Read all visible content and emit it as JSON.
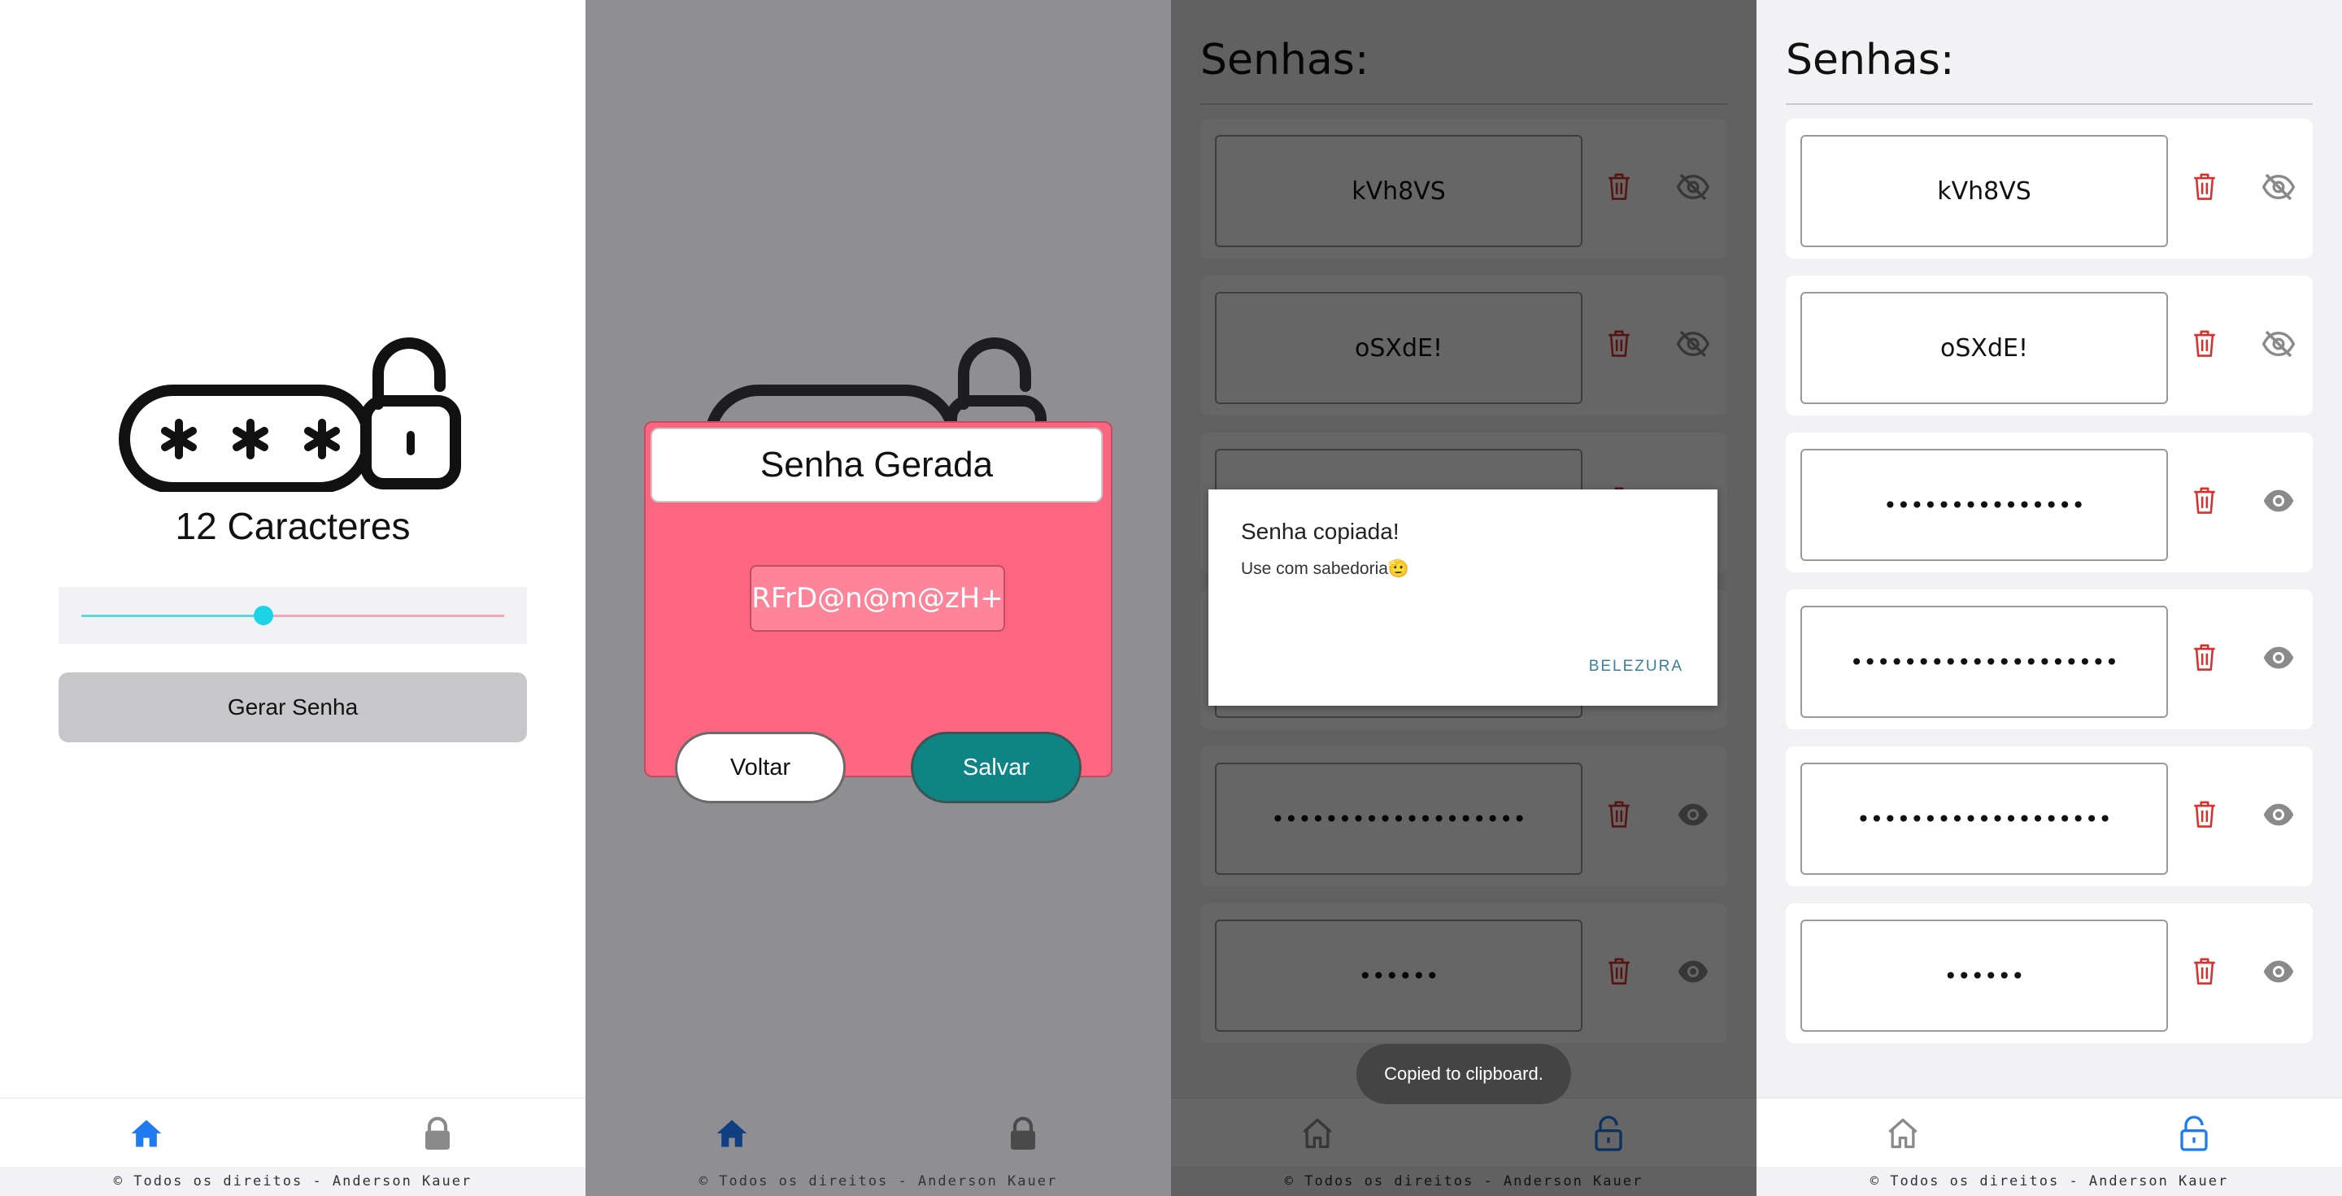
{
  "footer_text": "© Todos os direitos - Anderson Kauer",
  "colors": {
    "accent_blue": "#1e7cf0",
    "inactive_gray": "#8a8a8a",
    "modal_pink": "#fd6680",
    "save_teal": "#0e8584",
    "trash_red": "#d9302c",
    "slider_cyan": "#1fd3e6"
  },
  "screen1": {
    "chars_label": "12 Caracteres",
    "slider_value_fraction": 0.43,
    "generate_button": "Gerar Senha"
  },
  "screen2": {
    "modal_title": "Senha Gerada",
    "generated_password": "RFrD@n@m@zH+",
    "back_button": "Voltar",
    "save_button": "Salvar"
  },
  "passwords": {
    "title": "Senhas:",
    "items": [
      {
        "text": "kVh8VS",
        "visible": true
      },
      {
        "text": "oSXdE!",
        "visible": true
      },
      {
        "text": "•••••••••••••••",
        "visible": false
      },
      {
        "text": "••••••••••••••••••••",
        "visible": false
      },
      {
        "text": "•••••••••••••••••••",
        "visible": false
      },
      {
        "text": "••••••",
        "visible": false
      }
    ]
  },
  "dialog": {
    "title": "Senha copiada!",
    "message": "Use com sabedoria🫡",
    "button": "BELEZURA"
  },
  "toast": "Copied to clipboard.",
  "icons": {
    "home": "home-icon",
    "lock": "lock-icon",
    "trash": "trash-icon",
    "eye": "eye-icon",
    "eye_off": "eye-off-icon"
  }
}
